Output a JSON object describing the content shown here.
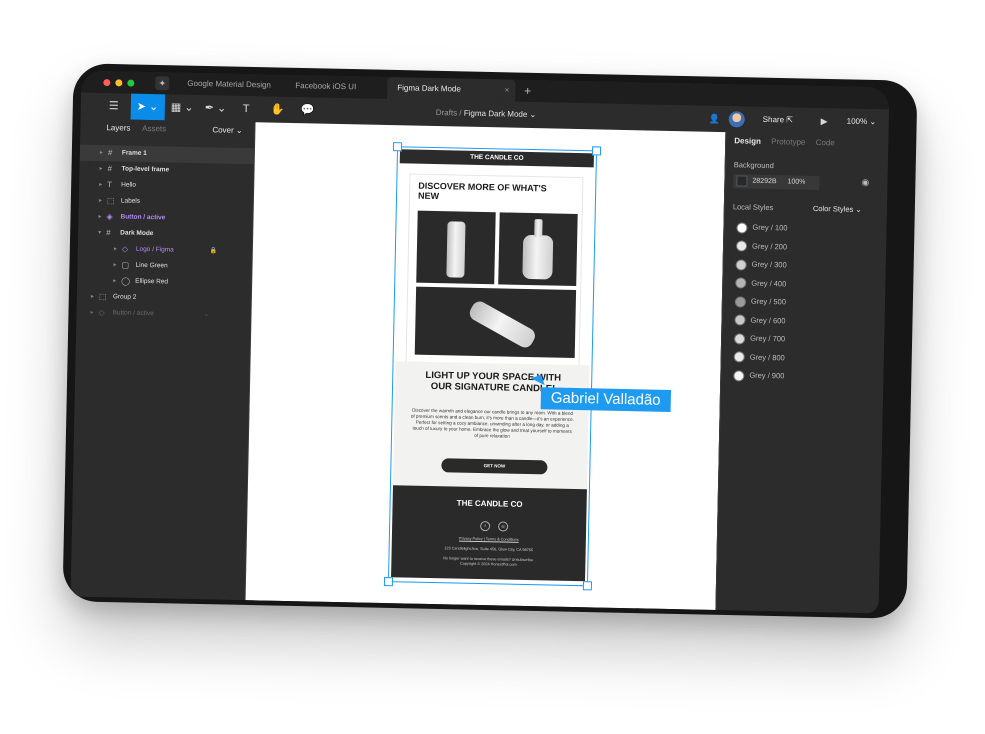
{
  "tabs": {
    "items": [
      "Google Material Design",
      "Facebook iOS UI"
    ],
    "active": "Figma Dark Mode",
    "close": "×",
    "new": "+"
  },
  "toolbar": {
    "breadcrumb_parent": "Drafts",
    "breadcrumb_sep": " / ",
    "breadcrumb_current": "Figma Dark Mode ⌄",
    "share": "Share",
    "zoom": "100% ⌄"
  },
  "left_panel": {
    "tab_layers": "Layers",
    "tab_assets": "Assets",
    "page_select": "Cover ⌄",
    "layers": [
      {
        "name": "Frame 1",
        "icon": "#",
        "style": "bold hl"
      },
      {
        "name": "Top-level frame",
        "icon": "#",
        "style": "bold"
      },
      {
        "name": "Hello",
        "icon": "T",
        "style": ""
      },
      {
        "name": "Labels",
        "icon": "⬚",
        "style": ""
      },
      {
        "name": "Button / active",
        "icon": "◈",
        "style": "purple bold"
      },
      {
        "name": "Dark Mode",
        "icon": "#",
        "style": "bold"
      },
      {
        "name": "Logo / Figma",
        "icon": "◇",
        "style": "purple"
      },
      {
        "name": "Line Green",
        "icon": "▢",
        "style": ""
      },
      {
        "name": "Ellipse Red",
        "icon": "◯",
        "style": ""
      },
      {
        "name": "Group 2",
        "icon": "⬚",
        "style": ""
      },
      {
        "name": "Button / active",
        "icon": "◇",
        "style": "dimmed"
      }
    ]
  },
  "right_panel": {
    "tab_design": "Design",
    "tab_prototype": "Prototype",
    "tab_code": "Code",
    "background_label": "Background",
    "bg_hex": "28292B",
    "bg_opacity": "100%",
    "local_styles": "Local Styles",
    "color_styles": "Color Styles ⌄",
    "styles": [
      {
        "name": "Grey / 100",
        "color": "#ffffff"
      },
      {
        "name": "Grey / 200",
        "color": "#e8e8e8"
      },
      {
        "name": "Grey / 300",
        "color": "#d0d0d0"
      },
      {
        "name": "Grey / 400",
        "color": "#b5b5b5"
      },
      {
        "name": "Grey / 500",
        "color": "#9a9a9a"
      },
      {
        "name": "Grey / 600",
        "color": "#c8c8c8"
      },
      {
        "name": "Grey / 700",
        "color": "#dadada"
      },
      {
        "name": "Grey / 800",
        "color": "#eaeaea"
      },
      {
        "name": "Grey / 900",
        "color": "#f6f6f6"
      }
    ]
  },
  "email": {
    "header": "THE CANDLE CO",
    "hero_title": "DISCOVER MORE OF WHAT'S NEW",
    "section_title": "LIGHT UP YOUR SPACE WITH OUR SIGNATURE CANDLE!",
    "body": "Discover the warmth and elegance our candle brings to any room. With a blend of premium scents and a clean burn, it's more than a candle—it's an experience. Perfect for setting a cozy ambiance, unwinding after a long day, or adding a touch of luxury to your home. Embrace the glow and treat yourself to moments of pure relaxation",
    "cta": "GET NOW",
    "footer_brand": "THE CANDLE CO",
    "footer_links": "Privacy Policy | Terms & Conditions",
    "footer_address": "123 Candlelight Ave, Suite 456, Glow City, CA 98765",
    "footer_unsub": "No longer want to receive these emails? Unsubscribe.",
    "footer_copy": "Copyright © 2024 HonestPot.com"
  },
  "collaborator": {
    "name": "Gabriel Valladão"
  }
}
